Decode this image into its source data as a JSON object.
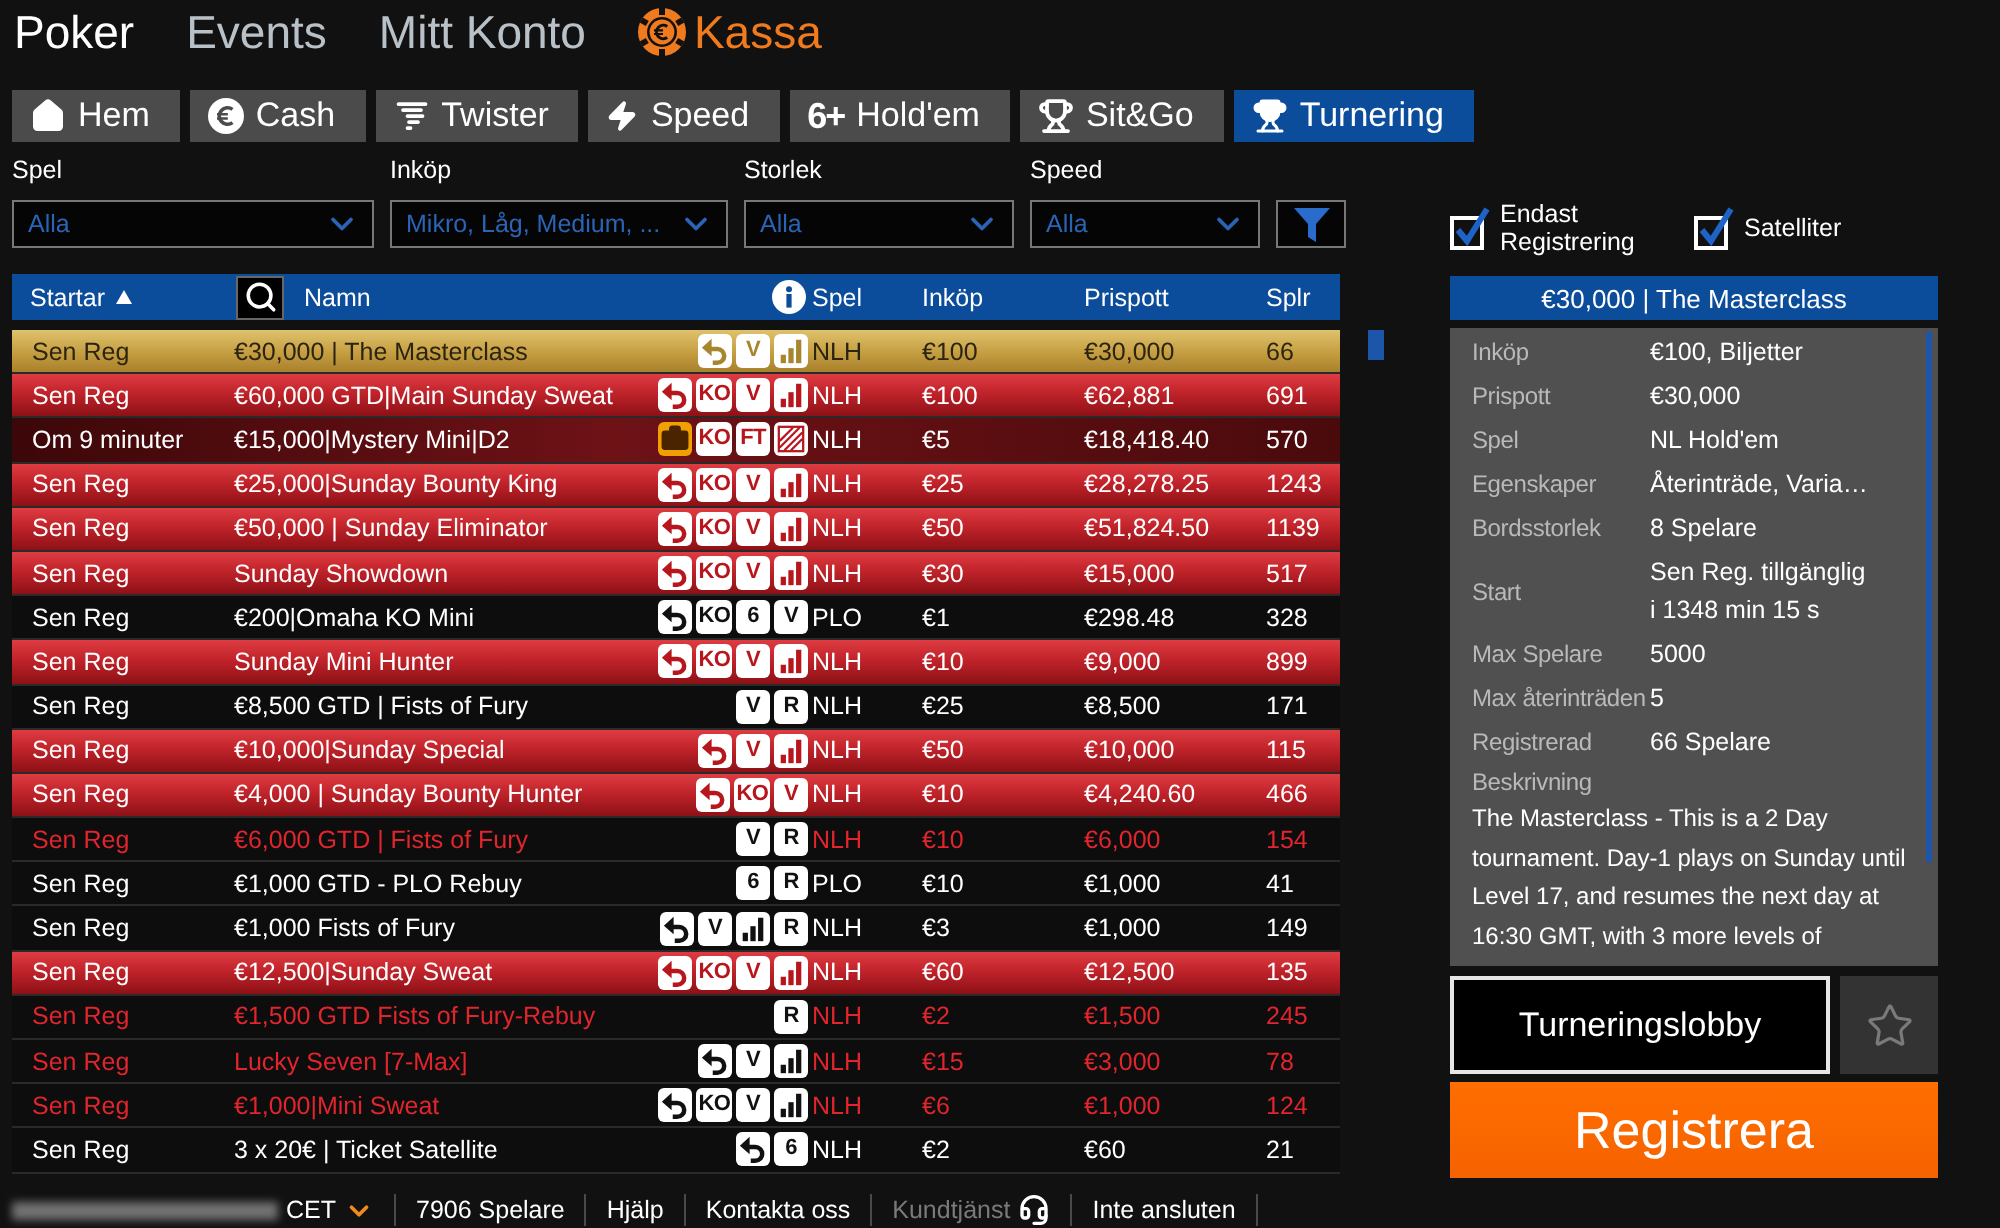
{
  "nav": [
    {
      "label": "Poker",
      "kind": "section",
      "selected": true
    },
    {
      "label": "Events",
      "kind": "section",
      "selected": false
    },
    {
      "label": "Mitt Konto",
      "kind": "section",
      "selected": false
    },
    {
      "label": "Kassa",
      "kind": "cashier",
      "selected": false
    }
  ],
  "tabs": [
    {
      "label": "Hem",
      "kind": "home",
      "selected": false
    },
    {
      "label": "Cash",
      "kind": "cash",
      "selected": false
    },
    {
      "label": "Twister",
      "kind": "twister",
      "selected": false
    },
    {
      "label": "Speed",
      "kind": "speed",
      "selected": false
    },
    {
      "label": "Hold'em",
      "kind": "holdem",
      "prefix": "6+",
      "selected": false
    },
    {
      "label": "Sit&Go",
      "kind": "sitgo",
      "selected": false
    },
    {
      "label": "Turnering",
      "kind": "tournament",
      "selected": true
    }
  ],
  "filters": [
    {
      "label": "Spel",
      "value": "Alla"
    },
    {
      "label": "Inköp",
      "value": "Mikro, Låg, Medium, ..."
    },
    {
      "label": "Storlek",
      "value": "Alla"
    },
    {
      "label": "Speed",
      "value": "Alla"
    }
  ],
  "options": [
    {
      "label": "Endast Registrering",
      "checked": true
    },
    {
      "label": "Satelliter",
      "checked": true
    }
  ],
  "table": {
    "columns": [
      {
        "label": "Startar",
        "kind": "text",
        "sorted": true
      },
      {
        "label": "Namn",
        "kind": "name",
        "sorted": false
      },
      {
        "label": "Spel",
        "kind": "text",
        "sorted": false
      },
      {
        "label": "Inköp",
        "kind": "text",
        "sorted": false
      },
      {
        "label": "Prispott",
        "kind": "text",
        "sorted": false
      },
      {
        "label": "Splr",
        "kind": "text",
        "sorted": false
      }
    ],
    "rows": [
      {
        "kind": "regular",
        "starts": "Sen Reg",
        "name": "€30,000 | The Masterclass",
        "badges": [
          {
            "kind": "reentry"
          },
          {
            "kind": "label",
            "text": "V"
          },
          {
            "kind": "levels"
          }
        ],
        "game": "NLH",
        "buy_in": "€100",
        "prize_pool": "€30,000",
        "players": "66",
        "selected": true,
        "red_text": false
      },
      {
        "kind": "featured",
        "starts": "Sen Reg",
        "name": "€60,000 GTD|Main Sunday Sweat",
        "badges": [
          {
            "kind": "reentry"
          },
          {
            "kind": "label",
            "text": "KO"
          },
          {
            "kind": "label",
            "text": "V"
          },
          {
            "kind": "levels"
          }
        ],
        "game": "NLH",
        "buy_in": "€100",
        "prize_pool": "€62,881",
        "players": "691",
        "selected": false,
        "red_text": false
      },
      {
        "kind": "mystery",
        "starts": "Om 9 minuter",
        "name": "€15,000|Mystery Mini|D2",
        "badges": [
          {
            "kind": "bag"
          },
          {
            "kind": "label",
            "text": "KO"
          },
          {
            "kind": "label",
            "text": "FT"
          },
          {
            "kind": "striped"
          }
        ],
        "game": "NLH",
        "buy_in": "€5",
        "prize_pool": "€18,418.40",
        "players": "570",
        "selected": false,
        "red_text": false
      },
      {
        "kind": "featured",
        "starts": "Sen Reg",
        "name": "€25,000|Sunday Bounty King",
        "badges": [
          {
            "kind": "reentry"
          },
          {
            "kind": "label",
            "text": "KO"
          },
          {
            "kind": "label",
            "text": "V"
          },
          {
            "kind": "levels"
          }
        ],
        "game": "NLH",
        "buy_in": "€25",
        "prize_pool": "€28,278.25",
        "players": "1243",
        "selected": false,
        "red_text": false
      },
      {
        "kind": "featured",
        "starts": "Sen Reg",
        "name": "€50,000 | Sunday Eliminator",
        "badges": [
          {
            "kind": "reentry"
          },
          {
            "kind": "label",
            "text": "KO"
          },
          {
            "kind": "label",
            "text": "V"
          },
          {
            "kind": "levels"
          }
        ],
        "game": "NLH",
        "buy_in": "€50",
        "prize_pool": "€51,824.50",
        "players": "1139",
        "selected": false,
        "red_text": false
      },
      {
        "kind": "featured",
        "starts": "Sen Reg",
        "name": "Sunday Showdown",
        "badges": [
          {
            "kind": "reentry"
          },
          {
            "kind": "label",
            "text": "KO"
          },
          {
            "kind": "label",
            "text": "V"
          },
          {
            "kind": "levels"
          }
        ],
        "game": "NLH",
        "buy_in": "€30",
        "prize_pool": "€15,000",
        "players": "517",
        "selected": false,
        "red_text": false
      },
      {
        "kind": "regular",
        "starts": "Sen Reg",
        "name": "€200|Omaha KO Mini",
        "badges": [
          {
            "kind": "reentry"
          },
          {
            "kind": "label",
            "text": "KO"
          },
          {
            "kind": "label",
            "text": "6"
          },
          {
            "kind": "label",
            "text": "V"
          }
        ],
        "game": "PLO",
        "buy_in": "€1",
        "prize_pool": "€298.48",
        "players": "328",
        "selected": false,
        "red_text": false
      },
      {
        "kind": "featured",
        "starts": "Sen Reg",
        "name": "Sunday Mini Hunter",
        "badges": [
          {
            "kind": "reentry"
          },
          {
            "kind": "label",
            "text": "KO"
          },
          {
            "kind": "label",
            "text": "V"
          },
          {
            "kind": "levels"
          }
        ],
        "game": "NLH",
        "buy_in": "€10",
        "prize_pool": "€9,000",
        "players": "899",
        "selected": false,
        "red_text": false
      },
      {
        "kind": "regular",
        "starts": "Sen Reg",
        "name": "€8,500 GTD | Fists of Fury",
        "badges": [
          {
            "kind": "label",
            "text": "V"
          },
          {
            "kind": "label",
            "text": "R"
          }
        ],
        "game": "NLH",
        "buy_in": "€25",
        "prize_pool": "€8,500",
        "players": "171",
        "selected": false,
        "red_text": false
      },
      {
        "kind": "featured",
        "starts": "Sen Reg",
        "name": "€10,000|Sunday Special",
        "badges": [
          {
            "kind": "reentry"
          },
          {
            "kind": "label",
            "text": "V"
          },
          {
            "kind": "levels"
          }
        ],
        "game": "NLH",
        "buy_in": "€50",
        "prize_pool": "€10,000",
        "players": "115",
        "selected": false,
        "red_text": false
      },
      {
        "kind": "featured",
        "starts": "Sen Reg",
        "name": "€4,000 | Sunday Bounty Hunter",
        "badges": [
          {
            "kind": "reentry"
          },
          {
            "kind": "label",
            "text": "KO"
          },
          {
            "kind": "label",
            "text": "V"
          }
        ],
        "game": "NLH",
        "buy_in": "€10",
        "prize_pool": "€4,240.60",
        "players": "466",
        "selected": false,
        "red_text": false
      },
      {
        "kind": "regular",
        "starts": "Sen Reg",
        "name": "€6,000 GTD | Fists of Fury",
        "badges": [
          {
            "kind": "label",
            "text": "V"
          },
          {
            "kind": "label",
            "text": "R"
          }
        ],
        "game": "NLH",
        "buy_in": "€10",
        "prize_pool": "€6,000",
        "players": "154",
        "selected": false,
        "red_text": true
      },
      {
        "kind": "regular",
        "starts": "Sen Reg",
        "name": "€1,000 GTD - PLO Rebuy",
        "badges": [
          {
            "kind": "label",
            "text": "6"
          },
          {
            "kind": "label",
            "text": "R"
          }
        ],
        "game": "PLO",
        "buy_in": "€10",
        "prize_pool": "€1,000",
        "players": "41",
        "selected": false,
        "red_text": false
      },
      {
        "kind": "regular",
        "starts": "Sen Reg",
        "name": "€1,000 Fists of Fury",
        "badges": [
          {
            "kind": "reentry"
          },
          {
            "kind": "label",
            "text": "V"
          },
          {
            "kind": "levels"
          },
          {
            "kind": "label",
            "text": "R"
          }
        ],
        "game": "NLH",
        "buy_in": "€3",
        "prize_pool": "€1,000",
        "players": "149",
        "selected": false,
        "red_text": false
      },
      {
        "kind": "featured",
        "starts": "Sen Reg",
        "name": "€12,500|Sunday Sweat",
        "badges": [
          {
            "kind": "reentry"
          },
          {
            "kind": "label",
            "text": "KO"
          },
          {
            "kind": "label",
            "text": "V"
          },
          {
            "kind": "levels"
          }
        ],
        "game": "NLH",
        "buy_in": "€60",
        "prize_pool": "€12,500",
        "players": "135",
        "selected": false,
        "red_text": false
      },
      {
        "kind": "regular",
        "starts": "Sen Reg",
        "name": "€1,500 GTD Fists of Fury-Rebuy",
        "badges": [
          {
            "kind": "label",
            "text": "R"
          }
        ],
        "game": "NLH",
        "buy_in": "€2",
        "prize_pool": "€1,500",
        "players": "245",
        "selected": false,
        "red_text": true
      },
      {
        "kind": "regular",
        "starts": "Sen Reg",
        "name": "Lucky Seven [7-Max]",
        "badges": [
          {
            "kind": "reentry"
          },
          {
            "kind": "label",
            "text": "V"
          },
          {
            "kind": "levels"
          }
        ],
        "game": "NLH",
        "buy_in": "€15",
        "prize_pool": "€3,000",
        "players": "78",
        "selected": false,
        "red_text": true
      },
      {
        "kind": "regular",
        "starts": "Sen Reg",
        "name": "€1,000|Mini Sweat",
        "badges": [
          {
            "kind": "reentry"
          },
          {
            "kind": "label",
            "text": "KO"
          },
          {
            "kind": "label",
            "text": "V"
          },
          {
            "kind": "levels"
          }
        ],
        "game": "NLH",
        "buy_in": "€6",
        "prize_pool": "€1,000",
        "players": "124",
        "selected": false,
        "red_text": true
      },
      {
        "kind": "regular",
        "starts": "Sen Reg",
        "name": "3 x 20€ | Ticket Satellite",
        "badges": [
          {
            "kind": "reentry"
          },
          {
            "kind": "label",
            "text": "6"
          }
        ],
        "game": "NLH",
        "buy_in": "€2",
        "prize_pool": "€60",
        "players": "21",
        "selected": false,
        "red_text": false
      }
    ]
  },
  "details": {
    "title": "€30,000 | The Masterclass",
    "fields": [
      {
        "label": "Inköp",
        "value": "€100, Biljetter"
      },
      {
        "label": "Prispott",
        "value": "€30,000"
      },
      {
        "label": "Spel",
        "value": "NL Hold'em"
      },
      {
        "label": "Egenskaper",
        "value": "Återinträde, Varia…"
      },
      {
        "label": "Bordsstorlek",
        "value": "8 Spelare"
      },
      {
        "label": "Start",
        "value": "Sen Reg. tillgänglig i 1348 min 15 s"
      },
      {
        "label": "Max Spelare",
        "value": "5000"
      },
      {
        "label": "Max återinträden",
        "value": "5"
      },
      {
        "label": "Registrerad",
        "value": "66 Spelare"
      }
    ],
    "description": {
      "label": "Beskrivning",
      "text": "The Masterclass - This is a 2 Day tournament. Day-1 plays on Sunday until Level 17, and resumes the next day at 16:30 GMT, with 3 more levels of"
    }
  },
  "actions": {
    "lobby": "Turneringslobby",
    "favorite": false,
    "register": "Registrera"
  },
  "status_bar": {
    "items": [
      {
        "kind": "timezone",
        "text": "CET"
      },
      {
        "kind": "count",
        "text": "7906 Spelare"
      },
      {
        "kind": "link",
        "text": "Hjälp",
        "disabled": false
      },
      {
        "kind": "link",
        "text": "Kontakta oss",
        "disabled": false
      },
      {
        "kind": "support",
        "text": "Kundtjänst",
        "disabled": true
      },
      {
        "kind": "status",
        "text": "Inte ansluten"
      }
    ]
  }
}
